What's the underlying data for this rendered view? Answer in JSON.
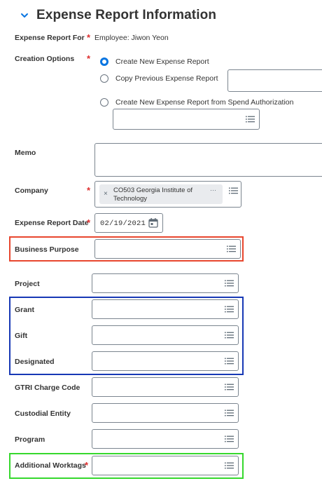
{
  "section": {
    "title": "Expense Report Information"
  },
  "expense_report_for": {
    "label": "Expense Report For",
    "value": "Employee: Jiwon Yeon"
  },
  "creation_options": {
    "label": "Creation Options",
    "options": [
      {
        "label": "Create New Expense Report",
        "selected": true
      },
      {
        "label": "Copy Previous Expense Report",
        "selected": false
      },
      {
        "label": "Create New Expense Report from Spend Authorization",
        "selected": false
      }
    ]
  },
  "memo": {
    "label": "Memo"
  },
  "company": {
    "label": "Company",
    "selected_line1": "CO503 Georgia Institute of",
    "selected_line2": "Technology",
    "remove_symbol": "×",
    "more_symbol": "···"
  },
  "expense_report_date": {
    "label": "Expense Report Date",
    "value": "02/19/2021"
  },
  "business_purpose": {
    "label": "Business Purpose"
  },
  "project": {
    "label": "Project"
  },
  "grant": {
    "label": "Grant"
  },
  "gift": {
    "label": "Gift"
  },
  "designated": {
    "label": "Designated"
  },
  "gtri_charge_code": {
    "label": "GTRI Charge Code"
  },
  "custodial_entity": {
    "label": "Custodial Entity"
  },
  "program": {
    "label": "Program"
  },
  "additional_worktags": {
    "label": "Additional Worktags"
  },
  "required_marker": "*",
  "icons": {
    "chevron": "chevron-down-icon",
    "prompt": "list-prompt-icon",
    "calendar": "calendar-icon"
  },
  "colors": {
    "accent": "#0875e1",
    "required": "#de2f2f",
    "highlight_red": "#e8462e",
    "highlight_blue": "#1738b5",
    "highlight_green": "#36d82d"
  }
}
